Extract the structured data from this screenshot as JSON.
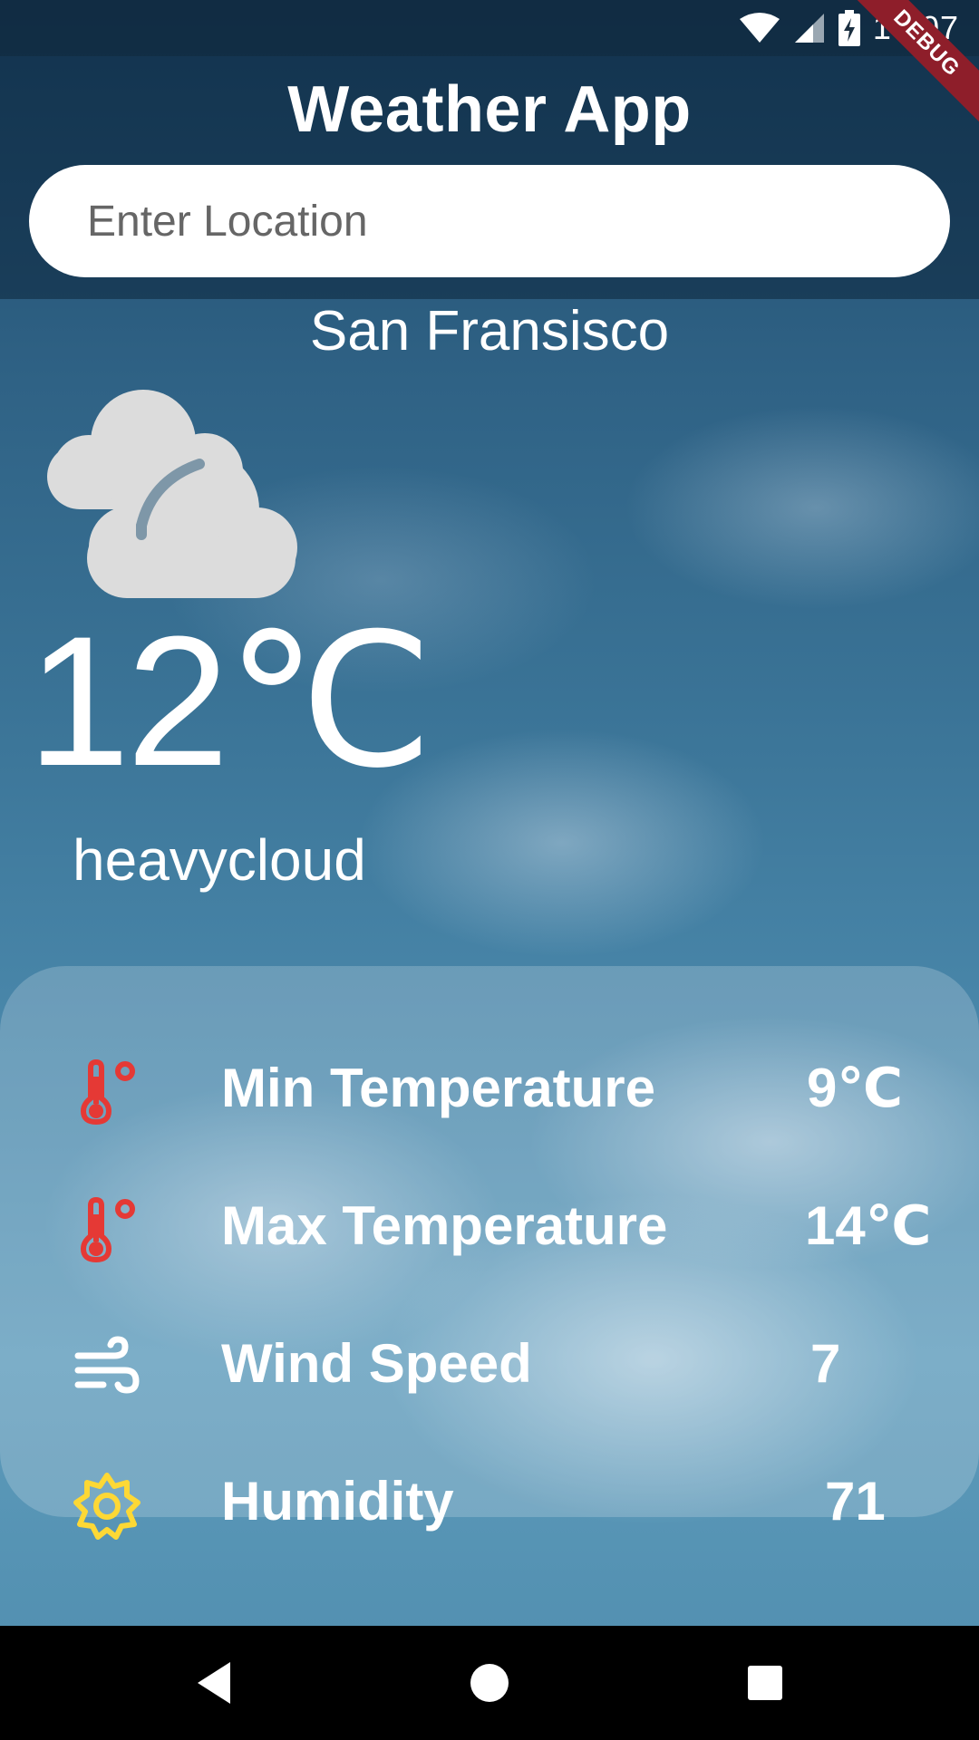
{
  "status_bar": {
    "time": "10:07",
    "icons": [
      "wifi-icon",
      "cell-signal-icon",
      "battery-charging-icon"
    ],
    "debug_label": "DEBUG"
  },
  "app_bar": {
    "title": "Weather App",
    "search": {
      "placeholder": "Enter Location",
      "value": ""
    }
  },
  "current": {
    "city": "San Fransisco",
    "condition_icon": "heavy-cloud-icon",
    "temperature": "12℃",
    "condition": "heavycloud"
  },
  "details": [
    {
      "icon": "thermometer-icon",
      "label": "Min Temperature",
      "value": "9℃",
      "icon_color": "#e53935"
    },
    {
      "icon": "thermometer-icon",
      "label": "Max Temperature",
      "value": "14℃",
      "icon_color": "#e53935"
    },
    {
      "icon": "wind-icon",
      "label": "Wind Speed",
      "value": "7",
      "icon_color": "#ffffff"
    },
    {
      "icon": "sun-icon",
      "label": "Humidity",
      "value": "71",
      "icon_color": "#fdd835"
    }
  ],
  "nav_bar": {
    "buttons": [
      "back-icon",
      "home-icon",
      "recents-icon"
    ]
  }
}
